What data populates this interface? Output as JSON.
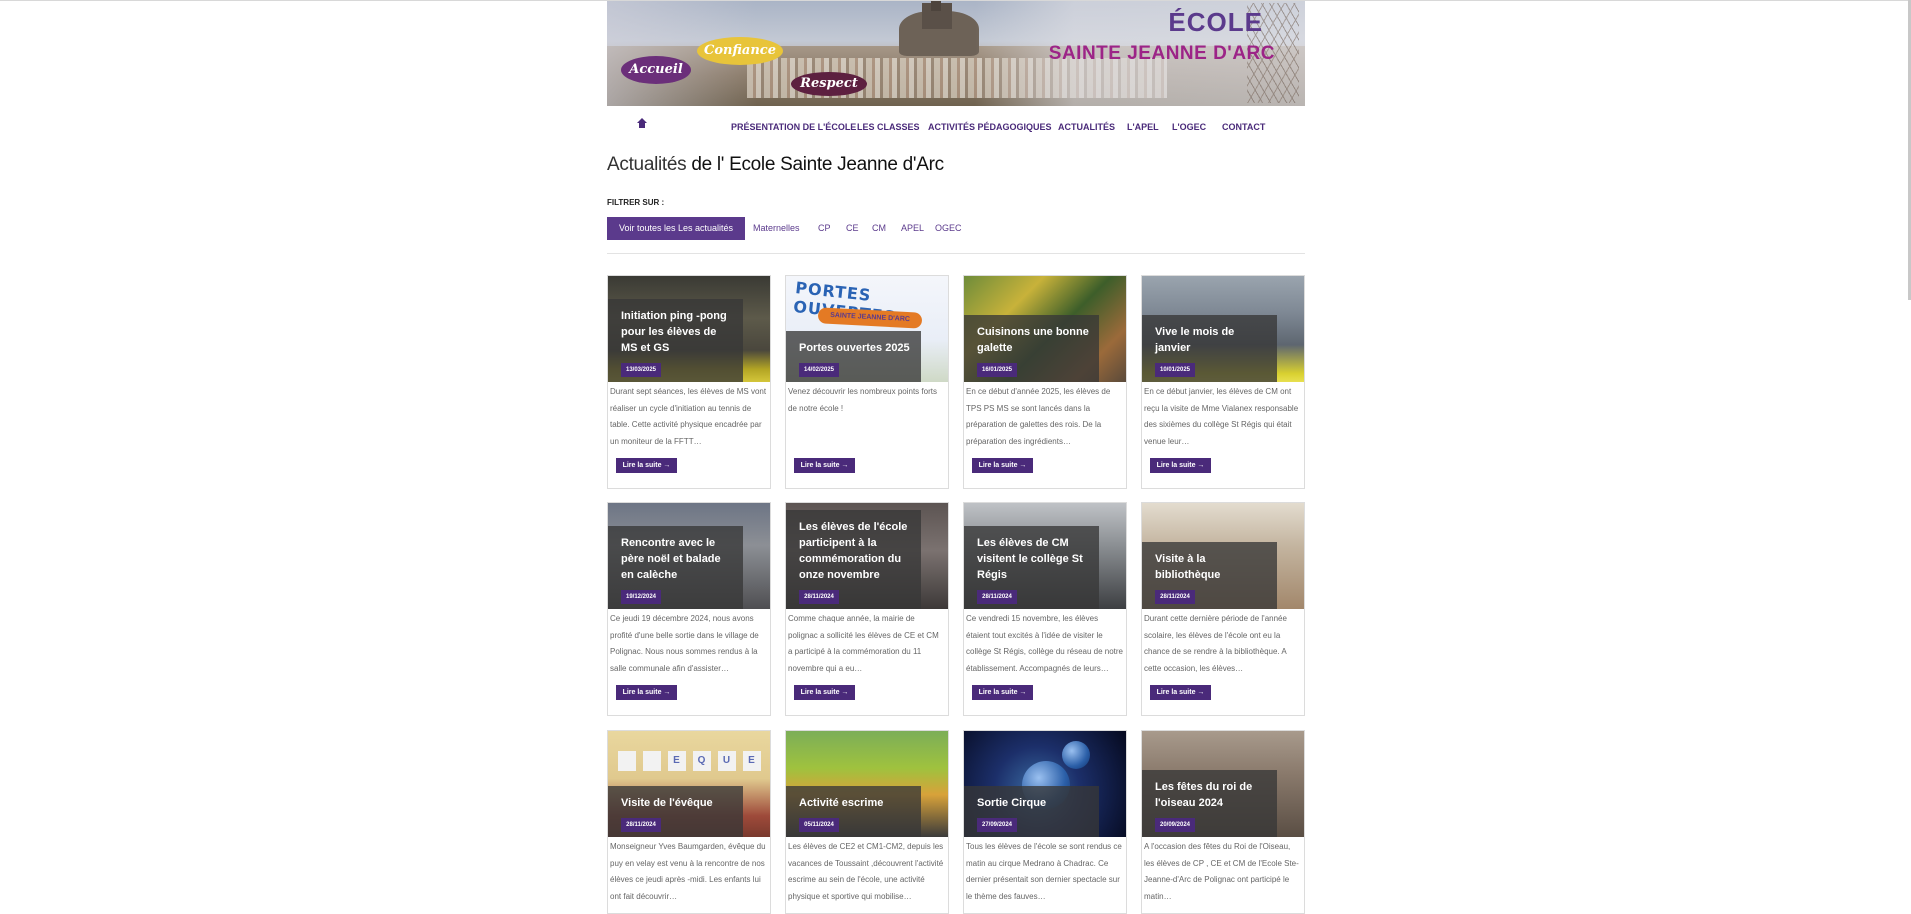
{
  "banner": {
    "words": [
      "Accueil",
      "Confiance",
      "Respect"
    ],
    "school_line1": "ÉCOLE",
    "school_line2": "SAINTE JEANNE D'ARC"
  },
  "nav": {
    "home_icon": "home-icon",
    "items": [
      "PRÉSENTATION DE L'ÉCOLE",
      "LES CLASSES",
      "ACTIVITÉS PÉDAGOGIQUES",
      "ACTUALITÉS",
      "L'APEL",
      "L'OGEC",
      "CONTACT"
    ]
  },
  "page": {
    "title_part1": "Actualités",
    "title_part2": " de l' Ecole Sainte Jeanne d'Arc",
    "filter_label": "FILTRER SUR :",
    "filters": {
      "active": "Voir toutes les Les actualités",
      "items": [
        "Maternelles",
        "CP",
        "CE",
        "CM",
        "APEL",
        "OGEC"
      ]
    }
  },
  "read_more": "Lire la suite →",
  "cards": [
    {
      "title": "Initiation ping -pong pour les élèves de MS et GS",
      "date": "13/03/2025",
      "excerpt": "Durant sept séances, les élèves de MS vont réaliser un cycle d'initiation au tennis de table. Cette activité physique encadrée par un moniteur de la FFTT…"
    },
    {
      "title": "Portes ouvertes 2025",
      "date": "14/02/2025",
      "excerpt": "Venez découvrir les nombreux points forts de notre école !",
      "image_text": "PORTES OUVERTES",
      "image_text2": "SAINTE JEANNE D'ARC"
    },
    {
      "title": "Cuisinons une bonne galette",
      "date": "16/01/2025",
      "excerpt": "En ce début d'année 2025, les élèves de TPS PS MS se sont lancés dans la préparation de galettes des rois. De la préparation des ingrédients…"
    },
    {
      "title": "Vive le mois de janvier",
      "date": "10/01/2025",
      "excerpt": "En ce début janvier, les élèves de CM ont reçu la visite de Mme Vialanex responsable des sixièmes du collège St Régis qui était venue leur…"
    },
    {
      "title": "Rencontre avec le père noël et balade en calèche",
      "date": "19/12/2024",
      "excerpt": "Ce jeudi 19 décembre 2024, nous avons profité d'une belle sortie dans le village de Polignac. Nous nous sommes rendus à la salle communale afin d'assister…"
    },
    {
      "title": "Les élèves de l'école participent à la commémoration du onze novembre",
      "date": "28/11/2024",
      "excerpt": "Comme chaque année, la mairie de polignac a sollicité les élèves de CE et CM a participé à la commémoration du 11 novembre qui a eu…"
    },
    {
      "title": "Les élèves de CM visitent le collège St Régis",
      "date": "28/11/2024",
      "excerpt": "Ce vendredi 15 novembre, les élèves étaient tout excités à l'idée de visiter le collège St Régis, collège du réseau de notre établissement. Accompagnés de leurs…"
    },
    {
      "title": "Visite à la bibliothèque",
      "date": "28/11/2024",
      "excerpt": "Durant cette dernière période de l'année scolaire, les élèves de l'école ont eu la chance de se rendre à la bibliothèque. A cette occasion, les élèves…"
    },
    {
      "title": "Visite de l'évêque",
      "date": "28/11/2024",
      "excerpt": "Monseigneur Yves Baumgarden, évêque du puy en velay est venu à la rencontre de nos élèves ce jeudi après -midi. Les enfants lui ont fait découvrir…",
      "image_letters": [
        "",
        "",
        "E",
        "Q",
        "U",
        "E"
      ]
    },
    {
      "title": "Activité escrime",
      "date": "05/11/2024",
      "excerpt": "Les élèves de CE2 et CM1-CM2, depuis les vacances de Toussaint ,découvrent l'activité escrime au sein de l'école, une activité physique et sportive qui mobilise…"
    },
    {
      "title": "Sortie Cirque",
      "date": "27/09/2024",
      "excerpt": "Tous les élèves de l'école se sont rendus ce matin au cirque Medrano à Chadrac. Ce dernier présentait son dernier spectacle sur le thème des fauves…"
    },
    {
      "title": "Les fêtes du roi de l'oiseau 2024",
      "date": "20/09/2024",
      "excerpt": "A l'occasion des fêtes du Roi de l'Oiseau, les élèves de CP , CE et CM de l'Ecole Ste-Jeanne-d'Arc de Polignac ont participé le matin…"
    }
  ]
}
